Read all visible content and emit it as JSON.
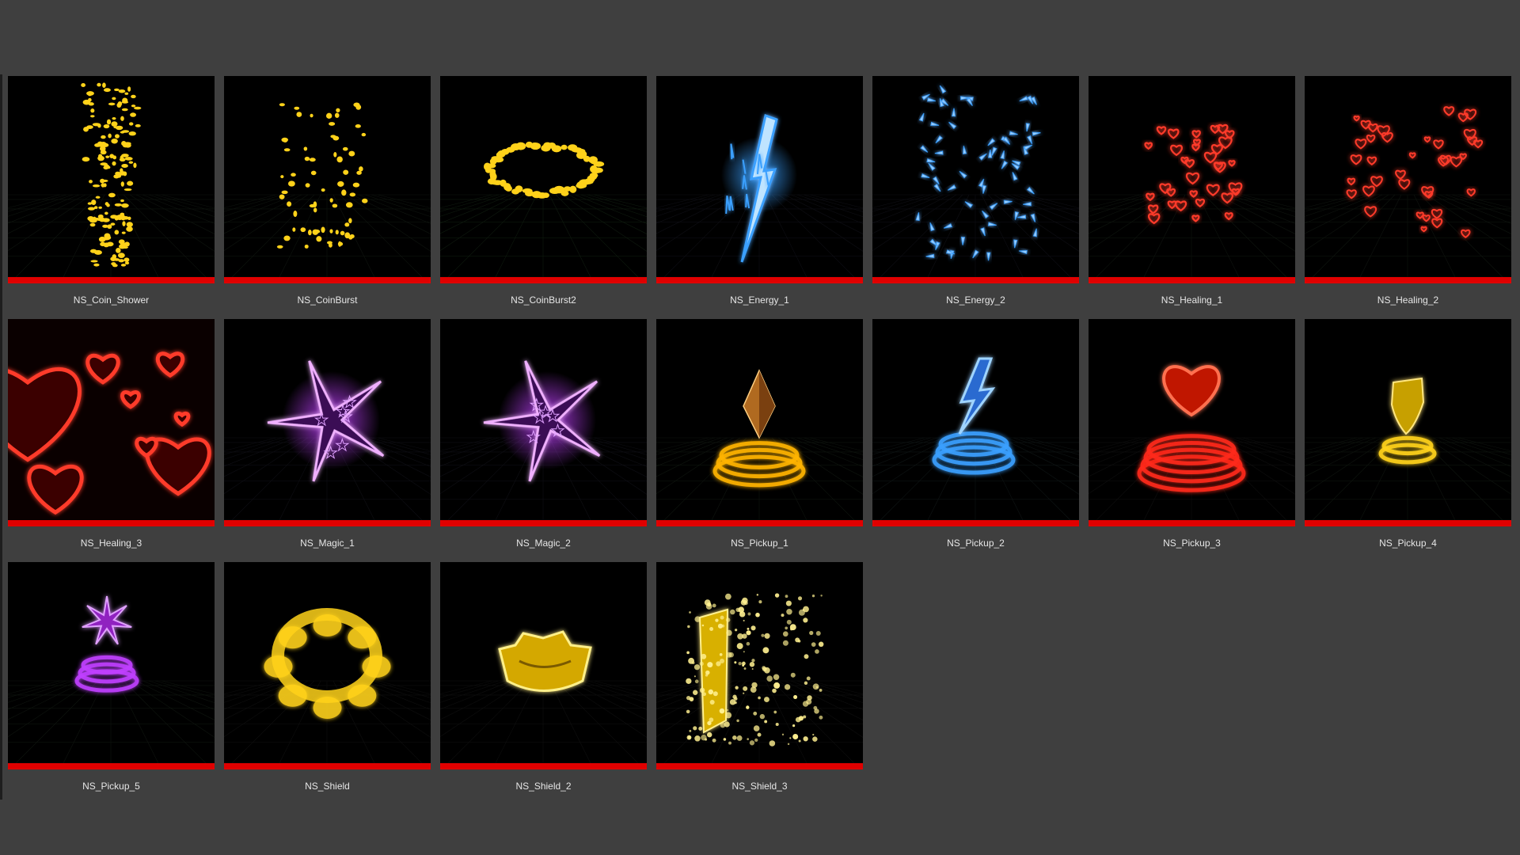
{
  "colors": {
    "background": "#3f3f3f",
    "thumbnail_bg": "#000000",
    "asset_type_bar": "#e00000",
    "label_text": "#e6e6e6"
  },
  "assets": [
    {
      "label": "NS_Coin_Shower",
      "icon": "coin-shower-effect-icon",
      "hue": "#ffd21a"
    },
    {
      "label": "NS_CoinBurst",
      "icon": "coin-burst-effect-icon",
      "hue": "#ffd21a"
    },
    {
      "label": "NS_CoinBurst2",
      "icon": "coin-ring-effect-icon",
      "hue": "#ffd21a"
    },
    {
      "label": "NS_Energy_1",
      "icon": "energy-bolt-effect-icon",
      "hue": "#3aa0ff"
    },
    {
      "label": "NS_Energy_2",
      "icon": "energy-shards-effect-icon",
      "hue": "#3aa0ff"
    },
    {
      "label": "NS_Healing_1",
      "icon": "hearts-cluster-effect-icon",
      "hue": "#ff3a2a"
    },
    {
      "label": "NS_Healing_2",
      "icon": "hearts-spread-effect-icon",
      "hue": "#ff3a2a"
    },
    {
      "label": "NS_Healing_3",
      "icon": "hearts-closeup-effect-icon",
      "hue": "#ff3a2a"
    },
    {
      "label": "NS_Magic_1",
      "icon": "magic-star-orb-effect-icon",
      "hue": "#c040ff"
    },
    {
      "label": "NS_Magic_2",
      "icon": "magic-star-orb-effect-icon",
      "hue": "#c040ff"
    },
    {
      "label": "NS_Pickup_1",
      "icon": "diamond-pickup-effect-icon",
      "hue": "#ffb400"
    },
    {
      "label": "NS_Pickup_2",
      "icon": "lightning-pickup-effect-icon",
      "hue": "#3aa0ff"
    },
    {
      "label": "NS_Pickup_3",
      "icon": "heart-pickup-effect-icon",
      "hue": "#ff2a1a"
    },
    {
      "label": "NS_Pickup_4",
      "icon": "shield-pickup-effect-icon",
      "hue": "#ffd21a"
    },
    {
      "label": "NS_Pickup_5",
      "icon": "star-pickup-effect-icon",
      "hue": "#c040ff"
    },
    {
      "label": "NS_Shield",
      "icon": "shield-ring-effect-icon",
      "hue": "#ffd21a"
    },
    {
      "label": "NS_Shield_2",
      "icon": "shield-crown-effect-icon",
      "hue": "#ffd21a"
    },
    {
      "label": "NS_Shield_3",
      "icon": "shield-sparkle-effect-icon",
      "hue": "#ffd21a"
    }
  ]
}
